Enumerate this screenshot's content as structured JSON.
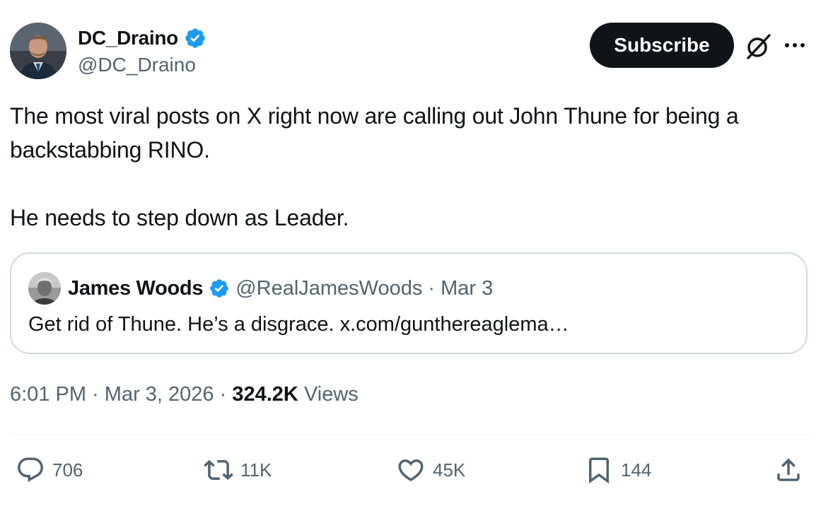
{
  "author": {
    "name": "DC_Draino",
    "handle": "@DC_Draino",
    "verified": true
  },
  "header_actions": {
    "subscribe_label": "Subscribe",
    "icons": [
      "grok-icon",
      "more-icon"
    ]
  },
  "tweet": {
    "line1": "The most viral posts on X right now are calling out John Thune for being a backstabbing RINO.",
    "line2": "He needs to step down as Leader."
  },
  "quote": {
    "name": "James Woods",
    "handle": "@RealJamesWoods",
    "separator": "·",
    "date": "Mar 3",
    "text": "Get rid of Thune. He’s a disgrace. x.com/gunthereaglema…"
  },
  "meta": {
    "time": "6:01 PM",
    "sep1": "·",
    "date": "Mar 3, 2026",
    "sep2": "·",
    "views_count": "324.2K",
    "views_label": "Views"
  },
  "actions": {
    "replies": "706",
    "reposts": "11K",
    "likes": "45K",
    "bookmarks": "144"
  },
  "colors": {
    "text": "#0f1419",
    "secondary": "#536471",
    "border": "#cfd9de",
    "verified_blue": "#1d9bf0",
    "button_bg": "#0f1419"
  }
}
